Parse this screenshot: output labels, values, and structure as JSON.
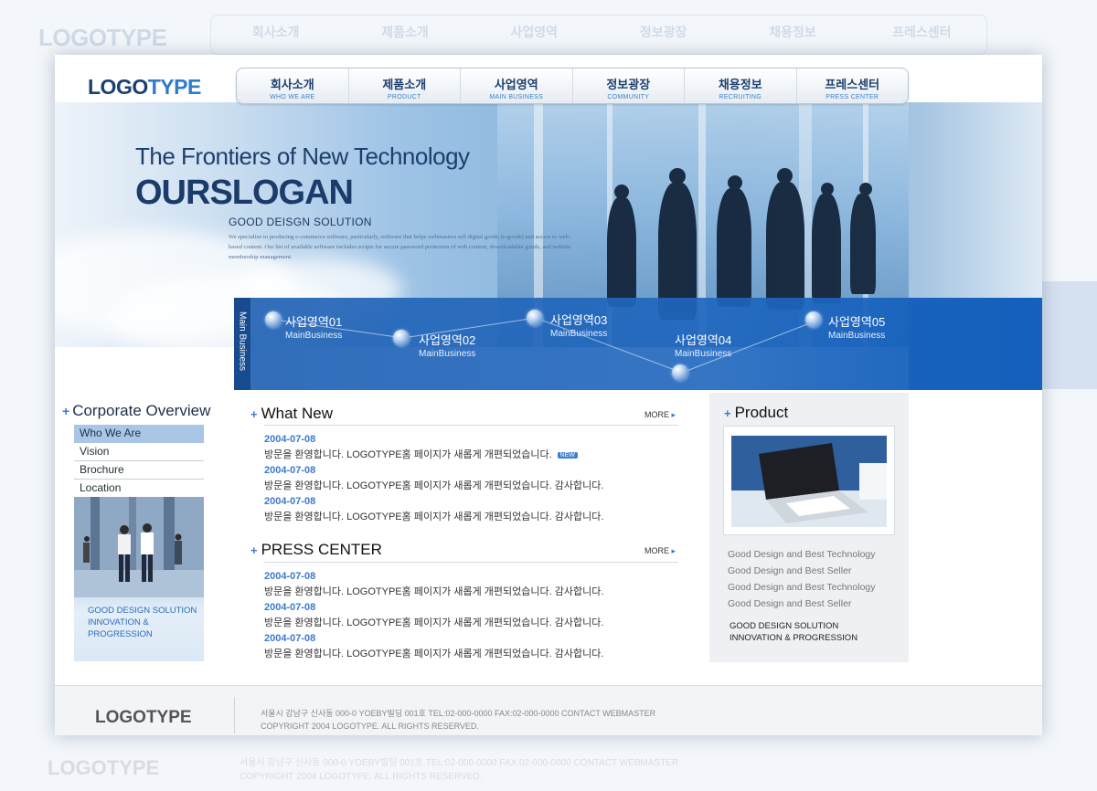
{
  "logo": {
    "part1": "LOGO",
    "part2": "TYPE"
  },
  "nav": [
    {
      "ko": "회사소개",
      "en": "WHO WE ARE"
    },
    {
      "ko": "제품소개",
      "en": "PRODUCT"
    },
    {
      "ko": "사업영역",
      "en": "MAIN BUSINESS"
    },
    {
      "ko": "정보광장",
      "en": "COMMUNITY"
    },
    {
      "ko": "채용정보",
      "en": "RECRUITING"
    },
    {
      "ko": "프레스센터",
      "en": "PRESS CENTER"
    }
  ],
  "hero": {
    "subtitle": "The Frontiers of New Technology",
    "slogan": "OURSLOGAN",
    "tagline": "GOOD DEISGN SOLUTION",
    "paragraph": "We specialize in producing e-commerce software, particularly, software that helps webmasters sell digital goods (e-goods) and access to web-based content. Our list of available software includes scripts for secure password protection of web content, downloadable goods, and website membership management."
  },
  "business": {
    "label": "Main Business",
    "items": [
      {
        "title": "사업영역01",
        "sub": "MainBusiness"
      },
      {
        "title": "사업영역02",
        "sub": "MainBusiness"
      },
      {
        "title": "사업영역03",
        "sub": "MainBusiness"
      },
      {
        "title": "사업영역04",
        "sub": "MainBusiness"
      },
      {
        "title": "사업영역05",
        "sub": "MainBusiness"
      }
    ]
  },
  "sidebar": {
    "title": "Corporate Overview",
    "items": [
      {
        "label": "Who We Are"
      },
      {
        "label": "Vision"
      },
      {
        "label": "Brochure"
      },
      {
        "label": "Location"
      }
    ],
    "banner_lines": [
      "GOOD DESIGN SOLUTION",
      "INNOVATION &",
      "PROGRESSION"
    ]
  },
  "whats_new": {
    "title": "What New",
    "more": "MORE",
    "badge": "NEW",
    "items": [
      {
        "date": "2004-07-08",
        "text": "방문을 환영합니다. LOGOTYPE홈 페이지가 새롭게 개편되었습니다."
      },
      {
        "date": "2004-07-08",
        "text": "방문을 환영합니다. LOGOTYPE홈 페이지가 새롭게 개편되었습니다. 감사합니다."
      },
      {
        "date": "2004-07-08",
        "text": "방문을 환영합니다. LOGOTYPE홈 페이지가 새롭게 개편되었습니다. 감사합니다."
      }
    ]
  },
  "press_center": {
    "title": "PRESS CENTER",
    "more": "MORE",
    "items": [
      {
        "date": "2004-07-08",
        "text": "방문을 환영합니다. LOGOTYPE홈 페이지가 새롭게 개편되었습니다. 감사합니다."
      },
      {
        "date": "2004-07-08",
        "text": "방문을 환영합니다. LOGOTYPE홈 페이지가 새롭게 개편되었습니다. 감사합니다."
      },
      {
        "date": "2004-07-08",
        "text": "방문을 환영합니다. LOGOTYPE홈 페이지가 새롭게 개편되었습니다. 감사합니다."
      }
    ]
  },
  "product": {
    "title": "Product",
    "links": [
      "Good Design and Best Technology",
      "Good Design and Best Seller",
      "Good Design and Best Technology",
      "Good Design and Best Seller"
    ],
    "tag_lines": [
      "GOOD DESIGN SOLUTION",
      "INNOVATION & PROGRESSION"
    ]
  },
  "footer": {
    "logo": "LOGOTYPE",
    "address": "서울시 강남구 신사동 000-0 YOEBY빌딩 001호 TEL:02-000-0000 FAX:02-000-0000 CONTACT WEBMASTER",
    "copyright": "COPYRIGHT 2004 LOGOTYPE. ALL RIGHTS RESERVED."
  },
  "colors": {
    "accent": "#3b7ad2",
    "navy": "#1b3f73",
    "band": "#1e66be"
  }
}
